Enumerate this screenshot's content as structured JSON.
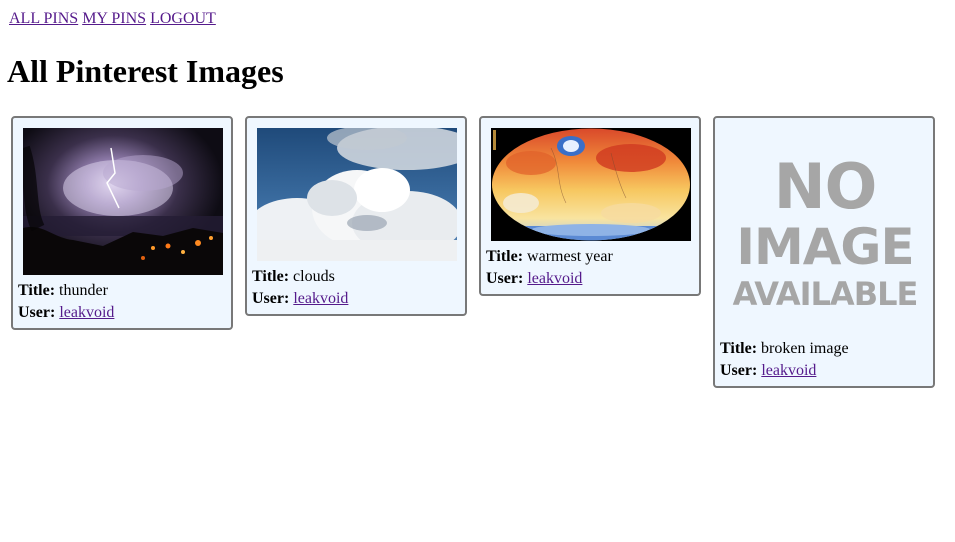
{
  "nav": {
    "all_pins": "ALL PINS",
    "my_pins": "MY PINS",
    "logout": "LOGOUT"
  },
  "page_title": "All Pinterest Images",
  "field_labels": {
    "title": "Title:",
    "user": "User:"
  },
  "pins": [
    {
      "title": "thunder",
      "user": "leakvoid",
      "image": "lightning-storm-over-town-at-night"
    },
    {
      "title": "clouds",
      "user": "leakvoid",
      "image": "cumulus-clouds-blue-sky"
    },
    {
      "title": "warmest year",
      "user": "leakvoid",
      "image": "global-temperature-anomaly-map"
    },
    {
      "title": "broken image",
      "user": "leakvoid",
      "image": "no-image-available-placeholder"
    }
  ],
  "placeholder": {
    "line1": "NO",
    "line2": "IMAGE",
    "line3": "AVAILABLE"
  },
  "colors": {
    "link": "#551a8b",
    "card_bg": "#eff7ff",
    "card_border": "#787878",
    "placeholder_text": "#a6a6a6"
  }
}
